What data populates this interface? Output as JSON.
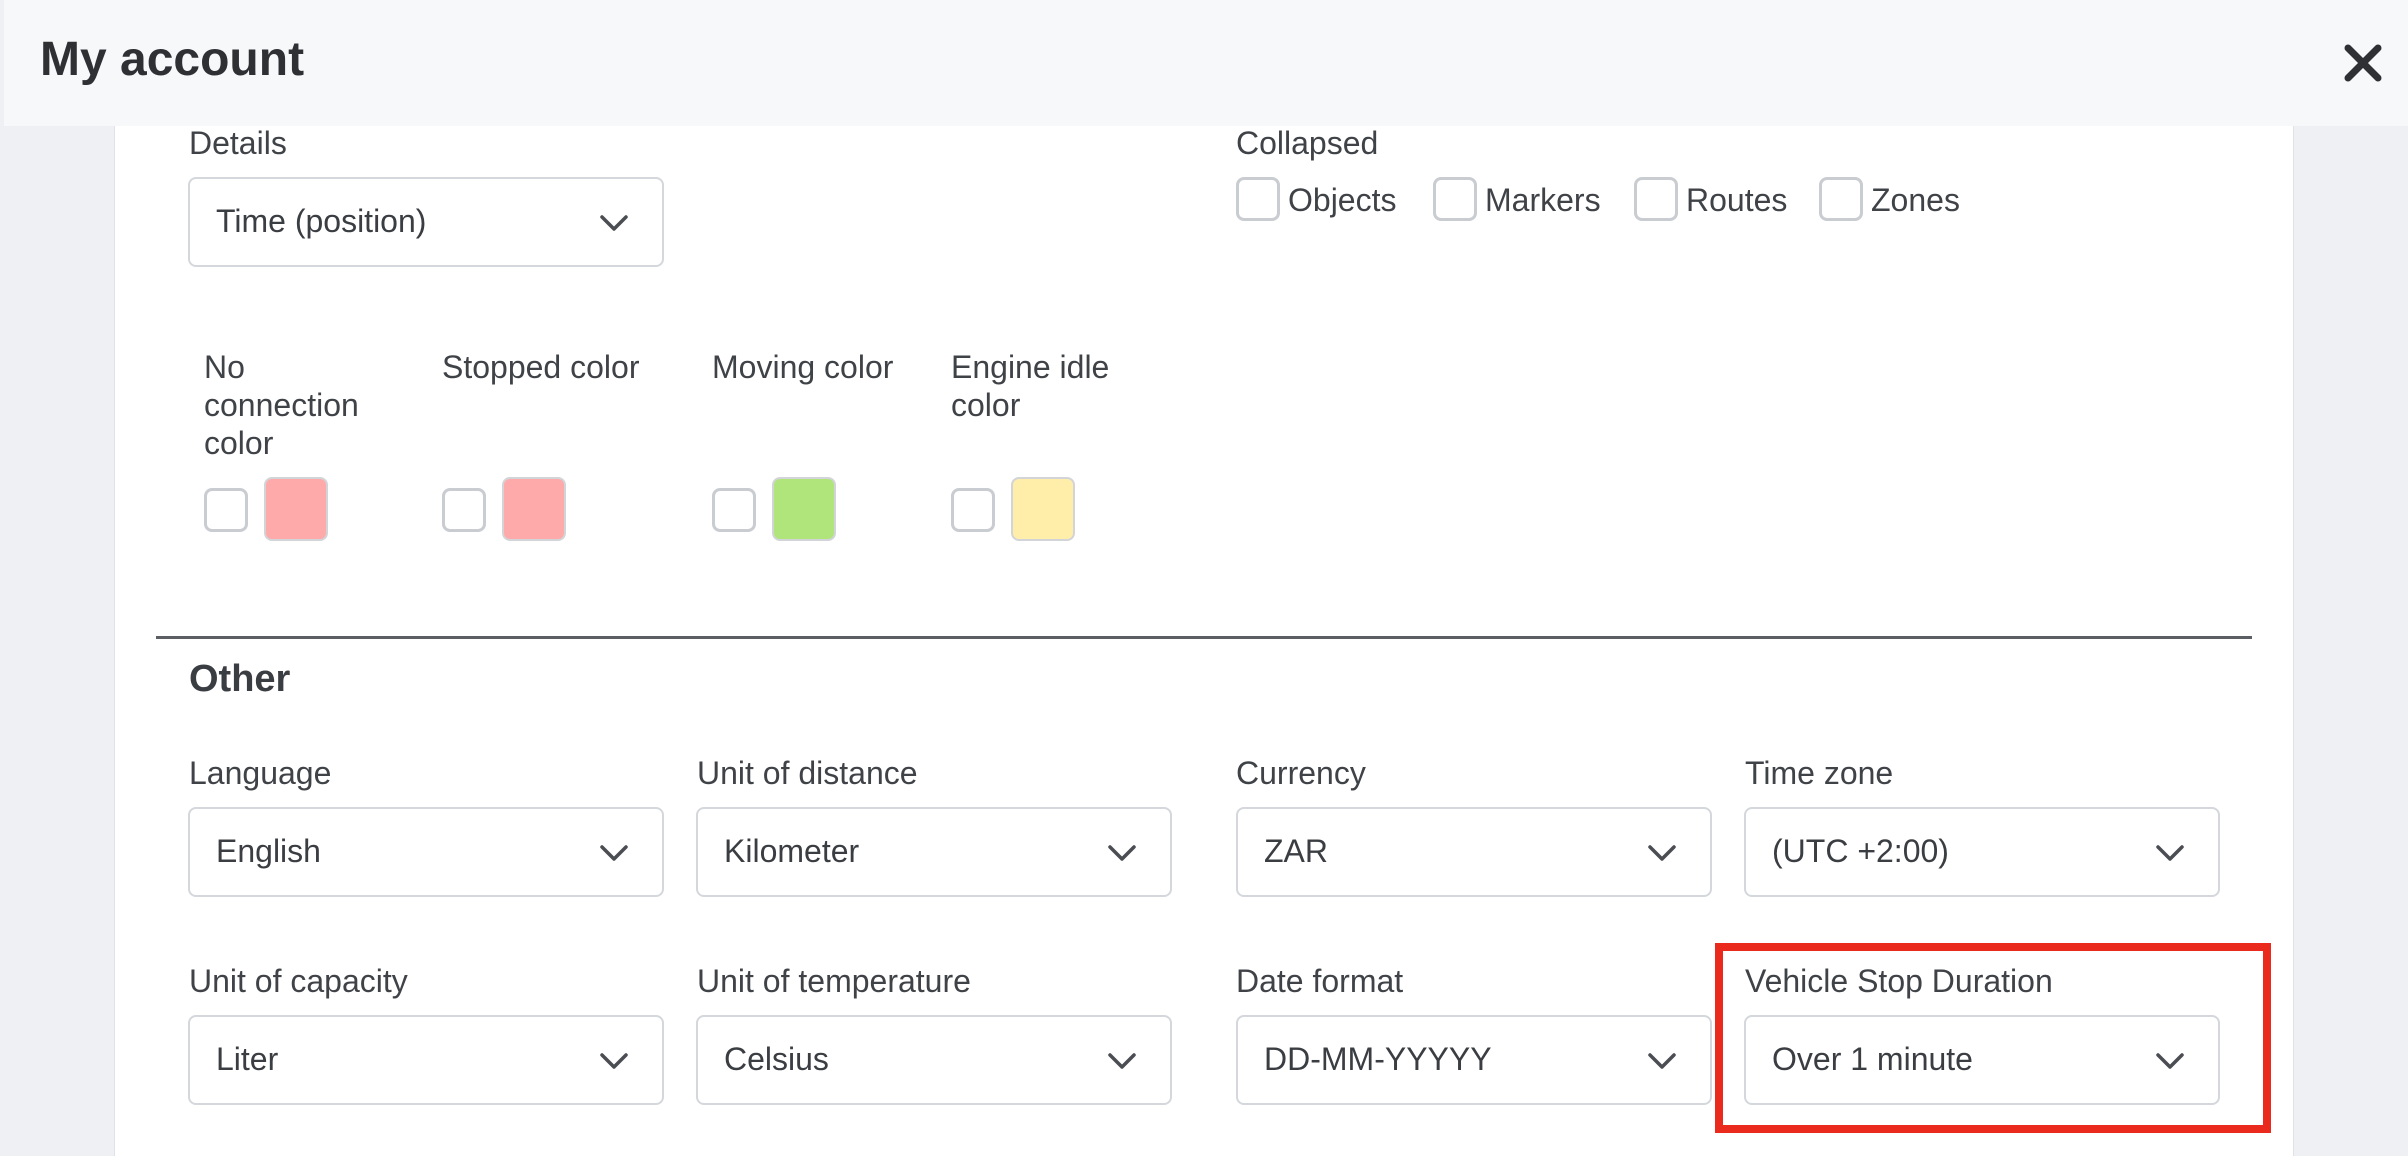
{
  "modal": {
    "title": "My account"
  },
  "icons": {
    "close": "close-icon",
    "chevron": "chevron-down-icon"
  },
  "details": {
    "label": "Details",
    "value": "Time (position)"
  },
  "collapsed": {
    "label": "Collapsed",
    "options": [
      {
        "label": "Objects",
        "checked": false
      },
      {
        "label": "Markers",
        "checked": false
      },
      {
        "label": "Routes",
        "checked": false
      },
      {
        "label": "Zones",
        "checked": false
      }
    ]
  },
  "colors": [
    {
      "label": "No connection color",
      "value": "#ffaaaa",
      "checked": false
    },
    {
      "label": "Stopped color",
      "value": "#ffaaaa",
      "checked": false
    },
    {
      "label": "Moving color",
      "value": "#b0e57c",
      "checked": false
    },
    {
      "label": "Engine idle color",
      "value": "#ffeeaa",
      "checked": false
    }
  ],
  "other": {
    "title": "Other",
    "fields": [
      {
        "label": "Language",
        "value": "English"
      },
      {
        "label": "Unit of distance",
        "value": "Kilometer"
      },
      {
        "label": "Currency",
        "value": "ZAR"
      },
      {
        "label": "Time zone",
        "value": "(UTC +2:00)"
      },
      {
        "label": "Unit of capacity",
        "value": "Liter"
      },
      {
        "label": "Unit of temperature",
        "value": "Celsius"
      },
      {
        "label": "Date format",
        "value": "DD-MM-YYYYY"
      },
      {
        "label": "Vehicle Stop Duration",
        "value": "Over 1 minute"
      }
    ]
  },
  "highlight_color": "#ea2a1d"
}
